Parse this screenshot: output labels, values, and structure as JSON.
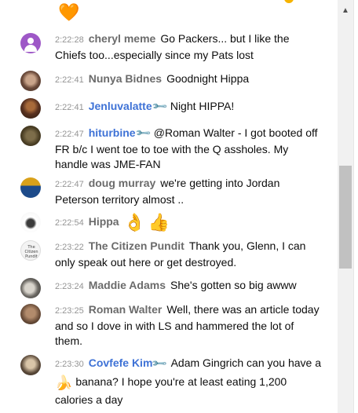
{
  "top_partial_emoji": "🧡",
  "messages": [
    {
      "time": "2:22:28",
      "author": "cheryl meme",
      "member": false,
      "text": "Go Packers... but I like the Chiefs too...especially since my Pats lost",
      "avatar": "person-icon"
    },
    {
      "time": "2:22:41",
      "author": "Nunya Bidnes",
      "member": false,
      "text": "Goodnight Hippa",
      "avatar": "photo"
    },
    {
      "time": "2:22:41",
      "author": "Jenluvalatte",
      "member": true,
      "text": "Night HIPPA!",
      "avatar": "photo"
    },
    {
      "time": "2:22:47",
      "author": "hiturbine",
      "member": true,
      "text": "@Roman Walter - I got booted off FR b/c I went toe to toe with the Q assholes. My handle was JME-FAN",
      "avatar": "photo"
    },
    {
      "time": "2:22:47",
      "author": "doug murray",
      "member": false,
      "text": "we're getting into Jordan Peterson territory almost ..",
      "avatar": "photo"
    },
    {
      "time": "2:22:54",
      "author": "Hippa",
      "member": false,
      "text": "",
      "emojis": [
        "👌",
        "👍"
      ],
      "avatar": "photo"
    },
    {
      "time": "2:23:22",
      "author": "The Citizen Pundit",
      "member": false,
      "text": "Thank you, Glenn, I can only speak out here or get destroyed.",
      "avatar": "logo",
      "avatar_text": "The Citizen Pundit"
    },
    {
      "time": "2:23:24",
      "author": "Maddie Adams",
      "member": false,
      "text": "She's gotten so big awww",
      "avatar": "photo"
    },
    {
      "time": "2:23:25",
      "author": "Roman Walter",
      "member": false,
      "text": "Well, there was an article today and so I dove in with LS and hammered the lot of them.",
      "avatar": "photo"
    },
    {
      "time": "2:23:30",
      "author": "Covfefe Kim",
      "member": true,
      "text_before": "Adam Gingrich can you have a",
      "inline_emoji": "🍌",
      "text_after": "banana? I hope you're at least eating 1,200 calories a day",
      "avatar": "photo"
    }
  ],
  "member_badge_icon": "wrench-icon",
  "colors": {
    "member_name": "#3e72d6",
    "author_name": "#6b6b6b",
    "timestamp": "#949494",
    "avatar_default": "#9e58c7",
    "scrollbar_track": "#f1f1f1",
    "scrollbar_thumb": "#c1c1c1"
  },
  "scrollbar": {
    "up_arrow": "▲"
  }
}
